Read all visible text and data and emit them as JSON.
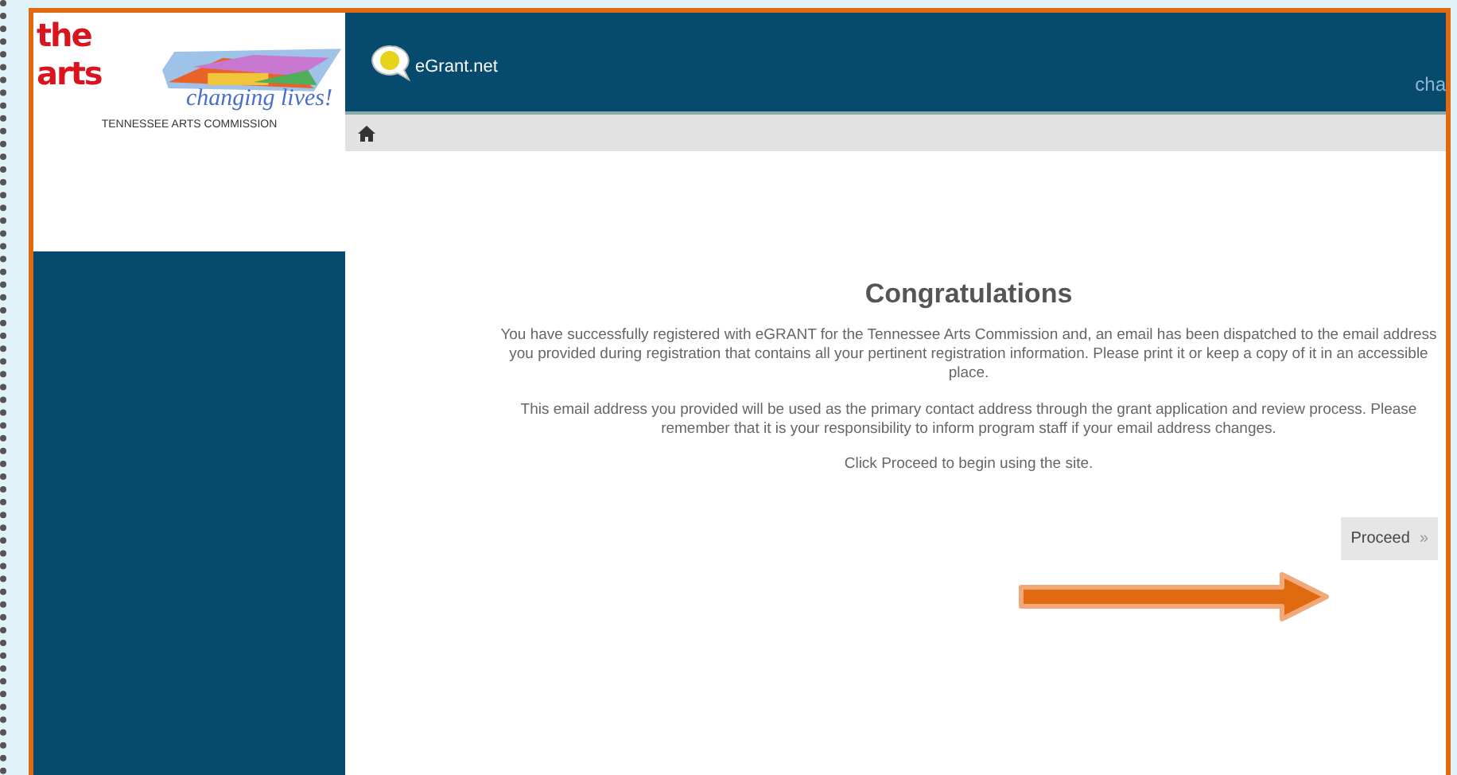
{
  "logo": {
    "brand": "the arts",
    "tagline": "changing lives!",
    "org": "TENNESSEE ARTS COMMISSION"
  },
  "header": {
    "site": "eGrant.net",
    "user": "cha"
  },
  "content": {
    "title": "Congratulations",
    "paragraphs": [
      "You have successfully registered with eGRANT for the Tennessee Arts Commission and, an email has been dispatched to the email address you provided during registration that contains all your pertinent registration information. Please print it or keep a copy of it in an accessible place.",
      "This email address you provided will be used as the primary contact address through the grant application and review process. Please remember that it is your responsibility to inform program staff if your email address changes.",
      "Click Proceed to begin using the site."
    ],
    "button": {
      "label": "Proceed",
      "arrow": "»"
    }
  }
}
